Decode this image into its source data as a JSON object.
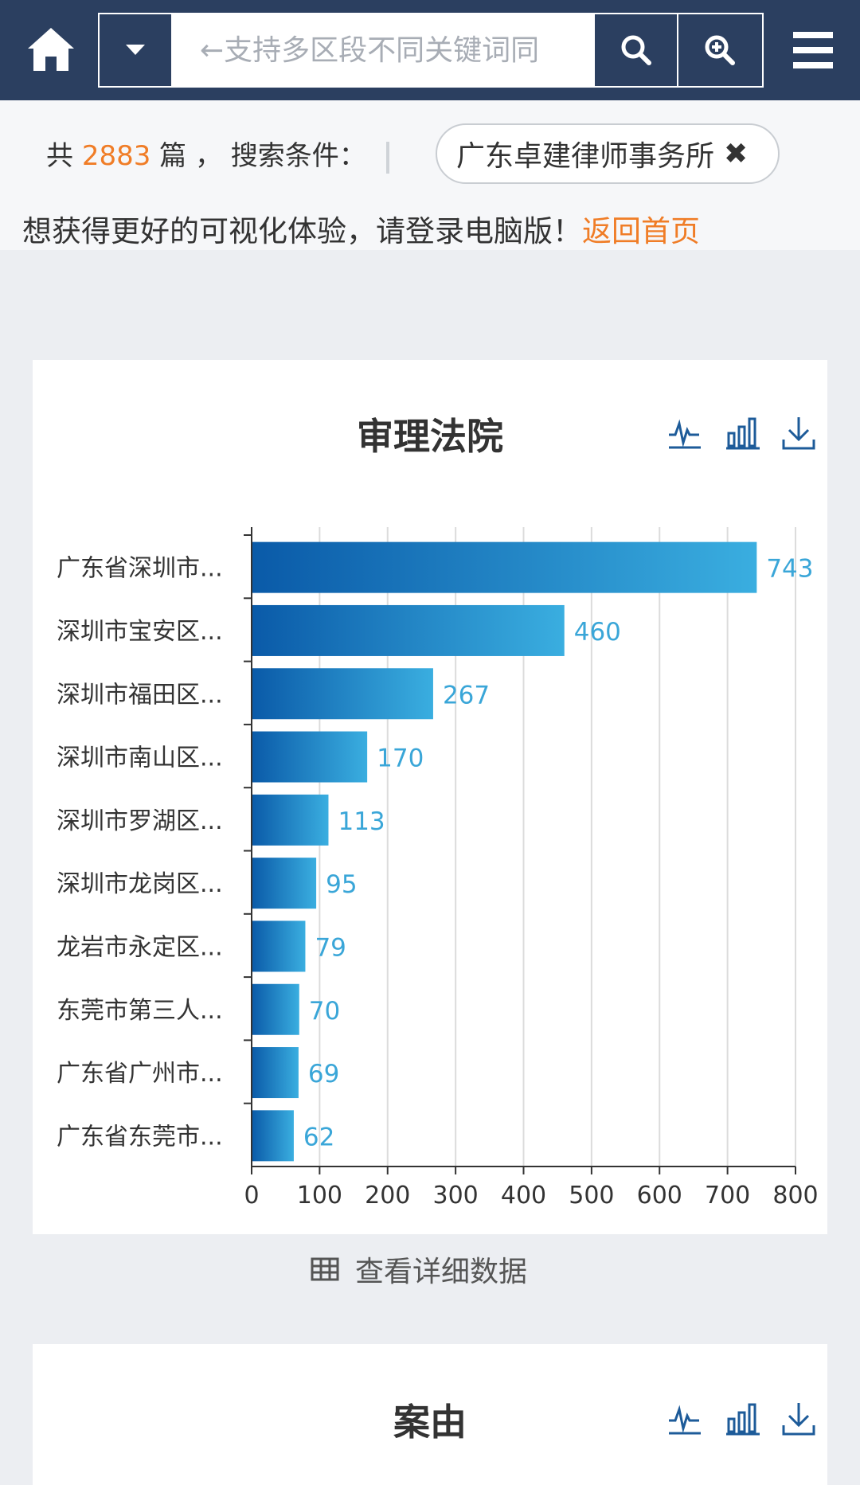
{
  "header": {
    "search_placeholder": "←支持多区段不同关键词同",
    "icons": [
      "home-icon",
      "caret-down-icon",
      "search-icon",
      "zoom-in-icon",
      "menu-icon"
    ]
  },
  "summary": {
    "prefix": "共",
    "count": "2883",
    "suffix": "篇 ，  搜索条件：",
    "tag": "广东卓建律师事务所",
    "tag_close": "✖"
  },
  "notice": {
    "text": "想获得更好的可视化体验，请登录电脑版！",
    "link": "返回首页"
  },
  "card1": {
    "title": "审理法院",
    "detail_link": "查看详细数据"
  },
  "card2": {
    "title": "案由"
  },
  "colors": {
    "header_bg": "#2b3f60",
    "accent_orange": "#f07d27",
    "bar_dark": "#0a5aa8",
    "bar_light": "#3aaee0",
    "label_blue": "#3aa6d8",
    "icon_blue": "#1d5b99"
  },
  "chart_data": {
    "type": "bar",
    "orientation": "horizontal",
    "title": "审理法院",
    "categories": [
      "广东省深圳市...",
      "深圳市宝安区...",
      "深圳市福田区...",
      "深圳市南山区...",
      "深圳市罗湖区...",
      "深圳市龙岗区...",
      "龙岩市永定区...",
      "东莞市第三人...",
      "广东省广州市...",
      "广东省东莞市..."
    ],
    "values": [
      743,
      460,
      267,
      170,
      113,
      95,
      79,
      70,
      69,
      62
    ],
    "xlim": [
      0,
      800
    ],
    "xticks": [
      0,
      100,
      200,
      300,
      400,
      500,
      600,
      700,
      800
    ],
    "grid": true
  }
}
